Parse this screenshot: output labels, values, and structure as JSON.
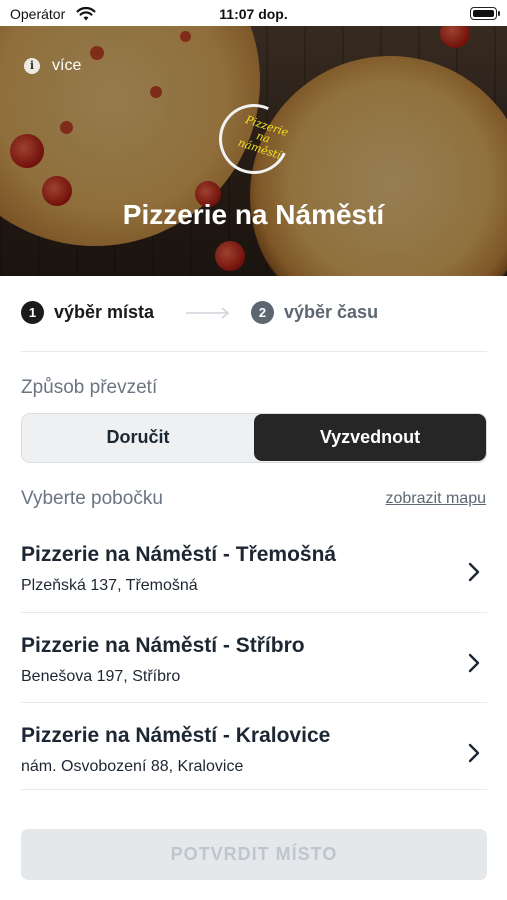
{
  "status_bar": {
    "carrier": "Operátor",
    "time": "11:07 dop.",
    "icons": [
      "wifi-icon",
      "battery-icon"
    ]
  },
  "hero": {
    "info_label": "více",
    "logo_text": "Pizzerie na náměstí",
    "title": "Pizzerie na Náměstí"
  },
  "stepper": {
    "steps": [
      {
        "number": "1",
        "label": "výběr místa",
        "active": true
      },
      {
        "number": "2",
        "label": "výběr času",
        "active": false
      }
    ]
  },
  "pickup": {
    "label": "Způsob převzetí",
    "options": [
      "Doručit",
      "Vyzvednout"
    ],
    "selected": "Vyzvednout"
  },
  "branches": {
    "label": "Vyberte pobočku",
    "map_link": "zobrazit mapu",
    "items": [
      {
        "name": "Pizzerie na Náměstí - Třemošná",
        "address": "Plzeňská 137, Třemošná"
      },
      {
        "name": "Pizzerie na Náměstí - Stříbro",
        "address": "Benešova 197, Stříbro"
      },
      {
        "name": "Pizzerie na Náměstí - Kralovice",
        "address": "nám. Osvobození 88, Kralovice"
      }
    ]
  },
  "confirm_button": "POTVRDIT MÍSTO",
  "colors": {
    "selected_segment": "#262626",
    "text_primary": "#1d2733",
    "text_muted": "#6b7581",
    "logo_yellow": "#f3e323",
    "disabled_button": "#e5e8eb"
  }
}
